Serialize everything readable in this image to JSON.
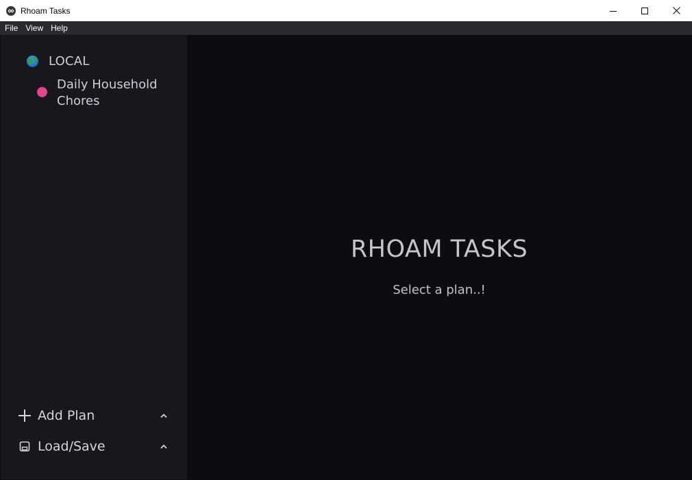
{
  "window": {
    "title": "Rhoam Tasks",
    "controls": [
      "minimize-icon",
      "maximize-icon",
      "close-icon"
    ]
  },
  "menubar": {
    "items": [
      {
        "label": "File"
      },
      {
        "label": "View"
      },
      {
        "label": "Help"
      }
    ]
  },
  "sidebar": {
    "root": {
      "label": "LOCAL",
      "icon": "globe-icon"
    },
    "plans": [
      {
        "label": "Daily Household Chores",
        "color": "#e0468c"
      }
    ],
    "actions": [
      {
        "label": "Add Plan",
        "icon": "plus-icon"
      },
      {
        "label": "Load/Save",
        "icon": "save-icon"
      }
    ]
  },
  "main": {
    "title": "RHOAM TASKS",
    "subtitle": "Select a plan..!"
  },
  "colors": {
    "sidebar_bg": "#17171d",
    "main_bg": "#0c0c11",
    "menubar_bg": "#2a2a2e",
    "plan_dot": "#e0468c",
    "text": "#cfcfd6"
  }
}
